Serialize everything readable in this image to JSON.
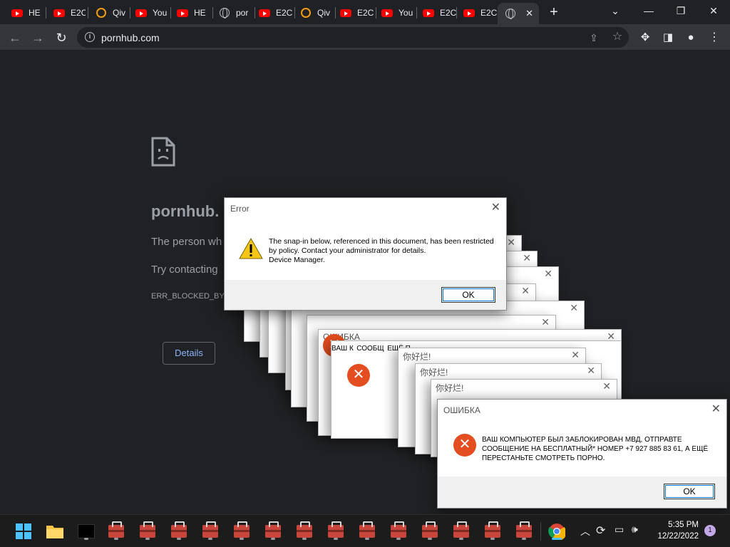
{
  "browser": {
    "tabs": [
      {
        "label": "HE",
        "favicon": "youtube-icon"
      },
      {
        "label": "E2C",
        "favicon": "youtube-icon"
      },
      {
        "label": "Qiv",
        "favicon": "qiwi-icon"
      },
      {
        "label": "You",
        "favicon": "youtube-icon"
      },
      {
        "label": "HE",
        "favicon": "youtube-icon"
      },
      {
        "label": "por",
        "favicon": "globe-icon"
      },
      {
        "label": "E2C",
        "favicon": "youtube-icon"
      },
      {
        "label": "Qiv",
        "favicon": "qiwi-icon"
      },
      {
        "label": "E2C",
        "favicon": "youtube-icon"
      },
      {
        "label": "You",
        "favicon": "youtube-icon"
      },
      {
        "label": "E2C",
        "favicon": "youtube-icon"
      },
      {
        "label": "E2C",
        "favicon": "youtube-icon"
      },
      {
        "label": "",
        "favicon": "globe-icon",
        "active": true
      }
    ],
    "address": "pornhub.com"
  },
  "error_page": {
    "title": "pornhub.",
    "line1": "The person wh",
    "line2": "Try contacting",
    "code": "ERR_BLOCKED_BY",
    "details_label": "Details"
  },
  "dialogs": {
    "error": {
      "title": "Error",
      "message": "The snap-in below, referenced in this document, has been restricted by policy. Contact your administrator for details.\nDevice Manager.",
      "ok": "OK"
    },
    "ransom": {
      "title": "ОШИБКА",
      "message": "ВАШ КОМПЬЮТЕР БЫЛ ЗАБЛОКИРОВАН МВД, ОТПРАВТЕ СООБЩЕНИЕ НА БЕСПЛАТНЫЙ* НОМЕР +7 927 885 83 61, А ЕЩЁ ПЕРЕСТАНЬТЕ СМОТРЕТЬ ПОРНО.",
      "ok": "OK"
    },
    "ghost_titles": [
      "ОШИБКА",
      "你好烂!",
      "你好烂!",
      "你好烂!"
    ],
    "ghost_message_fragments": [
      "ВАШ К",
      "СООБЩ",
      "ЕЩЁ П"
    ]
  },
  "taskbar": {
    "time": "5:35 PM",
    "date": "12/22/2022",
    "notification_count": "1"
  },
  "colors": {
    "chrome_bg": "#202124",
    "toolbar_bg": "#35363a",
    "error_icon": "#e34d1f",
    "link_blue": "#8ab4f8"
  }
}
